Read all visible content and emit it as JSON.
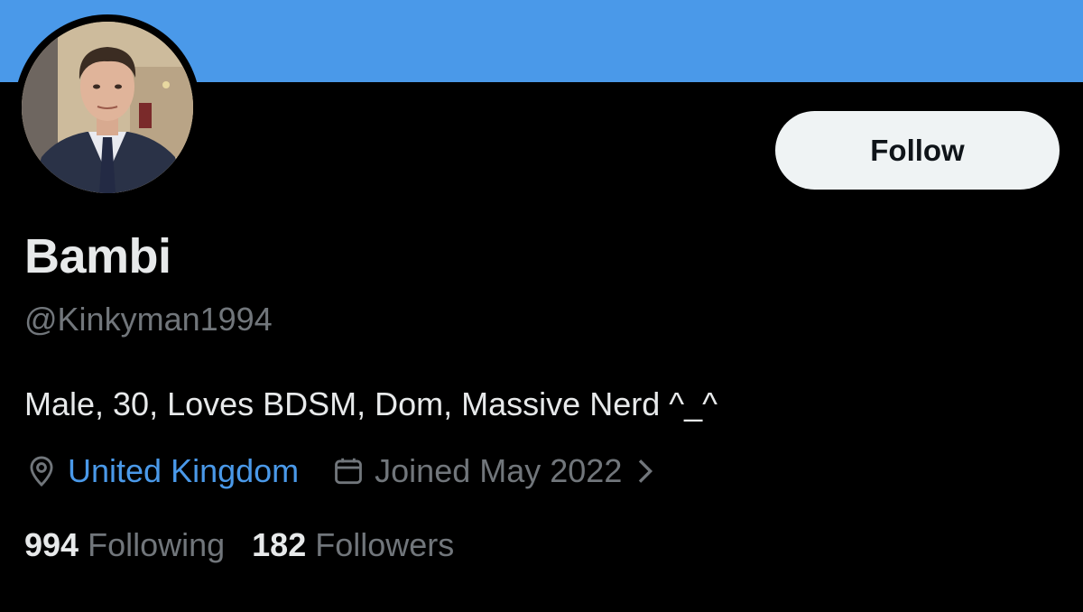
{
  "banner": {
    "color": "#4a99e9"
  },
  "profile": {
    "display_name": "Bambi",
    "handle": "@Kinkyman1994",
    "bio": "Male, 30, Loves BDSM, Dom, Massive Nerd ^_^",
    "avatar": "profile-photo"
  },
  "actions": {
    "follow_label": "Follow"
  },
  "meta": {
    "location": "United Kingdom",
    "location_icon": "map-pin-icon",
    "joined": "Joined May 2022",
    "joined_icon": "calendar-icon"
  },
  "stats": {
    "following_count": "994",
    "following_label": "Following",
    "followers_count": "182",
    "followers_label": "Followers"
  },
  "colors": {
    "accent": "#4a99e9",
    "muted": "#71767b",
    "text": "#e7e9ea",
    "background": "#000000"
  }
}
